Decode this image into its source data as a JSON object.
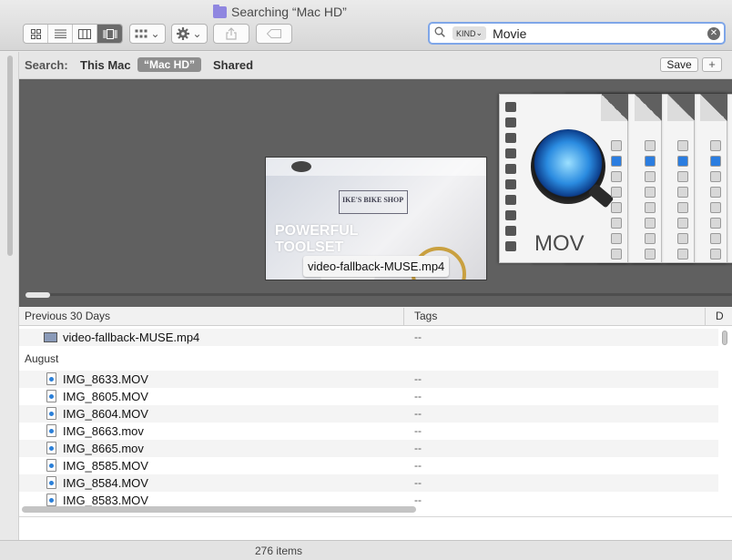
{
  "window": {
    "title": "Searching “Mac HD”"
  },
  "toolbar": {
    "view_modes": [
      "icon-view",
      "list-view",
      "column-view",
      "cover-flow-view"
    ],
    "active_view": "cover-flow-view",
    "arrange_caret": "⌄",
    "action_caret": "⌄"
  },
  "search": {
    "token_label": "KIND",
    "token_caret": "⌄",
    "value": "Movie"
  },
  "scope": {
    "label": "Search:",
    "items": [
      "This Mac",
      "“Mac HD”",
      "Shared"
    ],
    "selected": "“Mac HD”",
    "save_label": "Save",
    "add_label": "+"
  },
  "coverflow": {
    "preview_shop": "IKE'S BIKE SHOP",
    "preview_headline": "POWERFUL TOOLSET",
    "tooltip": "video-fallback-MUSE.mp4",
    "mov_label": "MOV"
  },
  "list": {
    "columns": [
      "Previous 30 Days",
      "Tags",
      "D"
    ],
    "groups": [
      {
        "header": "Previous 30 Days",
        "rows": [
          {
            "name": "video-fallback-MUSE.mp4",
            "tags": "--"
          }
        ]
      },
      {
        "header": "August",
        "rows": [
          {
            "name": "IMG_8633.MOV",
            "tags": "--"
          },
          {
            "name": "IMG_8605.MOV",
            "tags": "--"
          },
          {
            "name": "IMG_8604.MOV",
            "tags": "--"
          },
          {
            "name": "IMG_8663.mov",
            "tags": "--"
          },
          {
            "name": "IMG_8665.mov",
            "tags": "--"
          },
          {
            "name": "IMG_8585.MOV",
            "tags": "--"
          },
          {
            "name": "IMG_8584.MOV",
            "tags": "--"
          },
          {
            "name": "IMG_8583.MOV",
            "tags": "--"
          }
        ]
      }
    ]
  },
  "status": {
    "item_count": "276 items"
  }
}
